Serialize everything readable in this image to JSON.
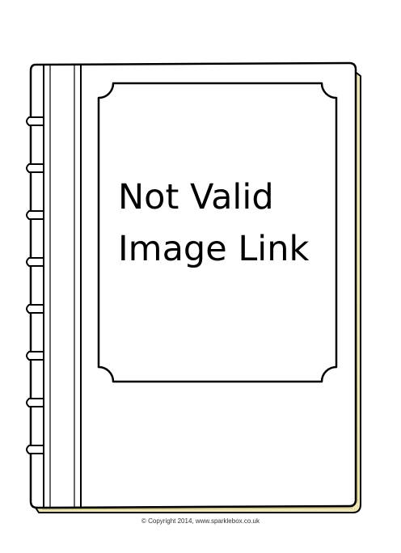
{
  "message": {
    "line1": "Not Valid",
    "line2": "Image Link"
  },
  "footer": {
    "copyright": "© Copyright 2014, www.sparklebox.co.uk"
  },
  "colors": {
    "outline": "#000000",
    "page_edge": "#efe6b8",
    "background": "#ffffff"
  },
  "icons": {
    "book": "book-icon"
  }
}
